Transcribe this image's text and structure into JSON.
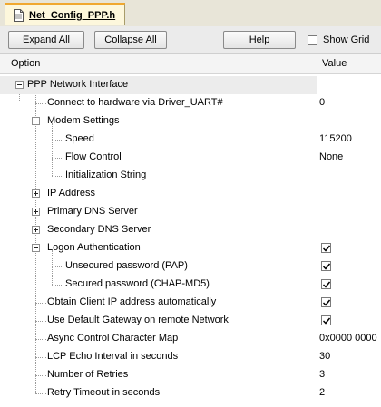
{
  "tab": {
    "title": "Net_Config_PPP.h",
    "icon": "document-icon"
  },
  "toolbar": {
    "expand_all": "Expand All",
    "collapse_all": "Collapse All",
    "help": "Help",
    "show_grid": "Show Grid",
    "show_grid_checked": false
  },
  "header": {
    "option": "Option",
    "value": "Value"
  },
  "rows": [
    {
      "label": "PPP Network Interface",
      "value": ""
    },
    {
      "label": "Connect to hardware via Driver_UART#",
      "value": "0"
    },
    {
      "label": "Modem Settings",
      "value": ""
    },
    {
      "label": "Speed",
      "value": "115200"
    },
    {
      "label": "Flow Control",
      "value": "None"
    },
    {
      "label": "Initialization String",
      "value": ""
    },
    {
      "label": "IP Address",
      "value": ""
    },
    {
      "label": "Primary DNS Server",
      "value": ""
    },
    {
      "label": "Secondary DNS Server",
      "value": ""
    },
    {
      "label": "Logon Authentication",
      "value": "",
      "checked": true
    },
    {
      "label": "Unsecured password (PAP)",
      "value": "",
      "checked": true
    },
    {
      "label": "Secured password (CHAP-MD5)",
      "value": "",
      "checked": true
    },
    {
      "label": "Obtain Client IP address automatically",
      "value": "",
      "checked": true
    },
    {
      "label": "Use Default Gateway on remote Network",
      "value": "",
      "checked": true
    },
    {
      "label": "Async Control Character Map",
      "value": "0x0000 0000"
    },
    {
      "label": "LCP Echo Interval in seconds",
      "value": "30"
    },
    {
      "label": "Number of Retries",
      "value": "3"
    },
    {
      "label": "Retry Timeout in seconds",
      "value": "2"
    }
  ]
}
